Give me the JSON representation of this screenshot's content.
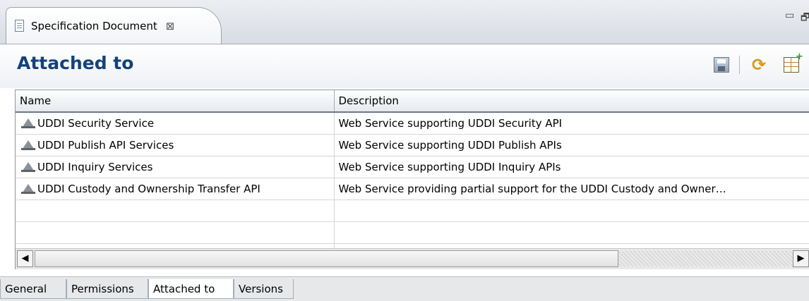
{
  "editor": {
    "tab_title": "Specification Document",
    "close_icon": "⊠"
  },
  "window_controls": {
    "minimize": "▭",
    "restore": "🗗"
  },
  "header": {
    "title": "Attached to"
  },
  "toolbar": {
    "save_icon": "save-icon",
    "refresh_icon": "refresh-icon",
    "columns_icon": "columns-icon"
  },
  "table": {
    "columns": [
      "Name",
      "Description"
    ],
    "rows": [
      {
        "name": "UDDI Security Service",
        "description": "Web Service supporting UDDI Security API"
      },
      {
        "name": "UDDI Publish API Services",
        "description": "Web Service supporting UDDI Publish APIs"
      },
      {
        "name": "UDDI Inquiry Services",
        "description": "Web Service supporting UDDI Inquiry APIs"
      },
      {
        "name": "UDDI Custody and Ownership Transfer API",
        "description": "Web Service providing partial support for the UDDI Custody and Owner…"
      }
    ]
  },
  "scrollbar": {
    "left": "◀",
    "right": "▶"
  },
  "bottom_tabs": [
    "General",
    "Permissions",
    "Attached to",
    "Versions"
  ],
  "active_bottom_tab": "Attached to"
}
